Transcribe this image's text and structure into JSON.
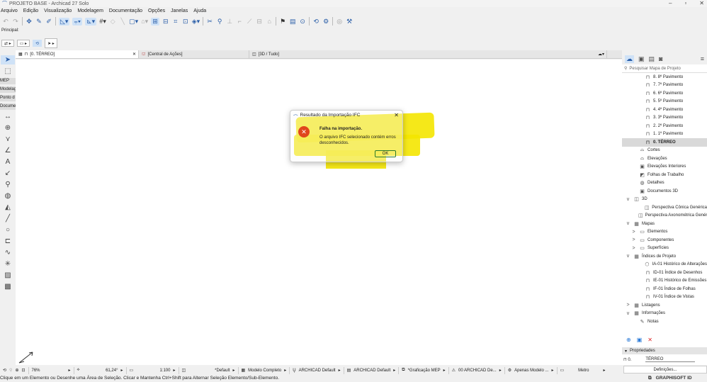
{
  "window": {
    "title": "PROJETO BASE - Archicad 27 Solo"
  },
  "menu": [
    "Arquivo",
    "Edição",
    "Visualização",
    "Modelagem",
    "Documentação",
    "Opções",
    "Janelas",
    "Ajuda"
  ],
  "toolbar_label": "Principal:",
  "tabs": [
    {
      "label": "[0. TÉRREO]"
    },
    {
      "label": "[Central de Ações]"
    },
    {
      "label": "[3D / Tudo]"
    }
  ],
  "toolbox": {
    "labels": [
      "MEP",
      "Modelag",
      "Ponto d",
      "Docume"
    ]
  },
  "dialog": {
    "title": "Resultado da Importação IFC",
    "heading": "Falha na importação.",
    "message": "O arquivo IFC selecionado contém erros desconhecidos.",
    "ok": "OK",
    "highlight_color": "#f4e600"
  },
  "navigator": {
    "search_placeholder": "Pesquisar Mapa de Projeto",
    "items": [
      {
        "label": "8. 8º Pavimento",
        "indent": 3,
        "icon": "story"
      },
      {
        "label": "7. 7º Pavimento",
        "indent": 3,
        "icon": "story"
      },
      {
        "label": "6. 6º Pavimento",
        "indent": 3,
        "icon": "story"
      },
      {
        "label": "5. 5º Pavimento",
        "indent": 3,
        "icon": "story"
      },
      {
        "label": "4. 4º Pavimento",
        "indent": 3,
        "icon": "story"
      },
      {
        "label": "3. 3º Pavimento",
        "indent": 3,
        "icon": "story"
      },
      {
        "label": "2. 2º Pavimento",
        "indent": 3,
        "icon": "story"
      },
      {
        "label": "1. 1º Pavimento",
        "indent": 3,
        "icon": "story"
      },
      {
        "label": "0. TÉRREO",
        "indent": 3,
        "icon": "story",
        "selected": true
      },
      {
        "label": "Cortes",
        "indent": 2,
        "icon": "section"
      },
      {
        "label": "Elevações",
        "indent": 2,
        "icon": "elevation"
      },
      {
        "label": "Elevações Interiores",
        "indent": 2,
        "icon": "interior"
      },
      {
        "label": "Folhas de Trabalho",
        "indent": 2,
        "icon": "worksheet"
      },
      {
        "label": "Detalhes",
        "indent": 2,
        "icon": "detail"
      },
      {
        "label": "Documentos 3D",
        "indent": 2,
        "icon": "doc3d"
      },
      {
        "label": "3D",
        "indent": 1,
        "icon": "3d",
        "toggle": "v"
      },
      {
        "label": "Perspectiva Cônica Genérica",
        "indent": 3,
        "icon": "cube"
      },
      {
        "label": "Perspectiva Axonométrica Genérica",
        "indent": 3,
        "icon": "cube"
      },
      {
        "label": "Mapas",
        "indent": 1,
        "icon": "table",
        "toggle": "v"
      },
      {
        "label": "Elementos",
        "indent": 2,
        "icon": "list",
        "toggle": ">"
      },
      {
        "label": "Componentes",
        "indent": 2,
        "icon": "list",
        "toggle": ">"
      },
      {
        "label": "Superfícies",
        "indent": 2,
        "icon": "list",
        "toggle": ">"
      },
      {
        "label": "Índices de Projeto",
        "indent": 1,
        "icon": "table",
        "toggle": "v"
      },
      {
        "label": "IA-01 Histórico de Alterações",
        "indent": 3,
        "icon": "hex"
      },
      {
        "label": "ID-01 Índice de Desenhos",
        "indent": 3,
        "icon": "story"
      },
      {
        "label": "IE-01 Histórico de Emissões",
        "indent": 3,
        "icon": "story"
      },
      {
        "label": "IF-01 Índice de Folhas",
        "indent": 3,
        "icon": "story"
      },
      {
        "label": "IV-01 Índice de Vistas",
        "indent": 3,
        "icon": "story"
      },
      {
        "label": "Listagens",
        "indent": 1,
        "icon": "table",
        "toggle": ">"
      },
      {
        "label": "Informações",
        "indent": 1,
        "icon": "table",
        "toggle": "v"
      },
      {
        "label": "Notas",
        "indent": 2,
        "icon": "note"
      }
    ]
  },
  "properties": {
    "title": "Propriedades",
    "id": "0.",
    "name": "TÉRREO",
    "settings": "Definições..."
  },
  "status": {
    "zoom": "76%",
    "angle": "61,24°",
    "scale": "1:100",
    "layer": "*Default",
    "model": "Modelo Completo",
    "pen": "ARCHICAD Default",
    "dim": "ARCHICAD Default",
    "graphic": "*Graficação MEP",
    "renov": "00 ARCHICAD De...",
    "filter": "Apenas Modelo ...",
    "unit": "Metro"
  },
  "message": "Clique em um Elemento ou Desenhe uma Área de Seleção. Clicar e Mantenha Ctrl+Shift para Alternar Seleção Elemento/Sub-Elemento.",
  "brand": "GRAPHISOFT ID"
}
